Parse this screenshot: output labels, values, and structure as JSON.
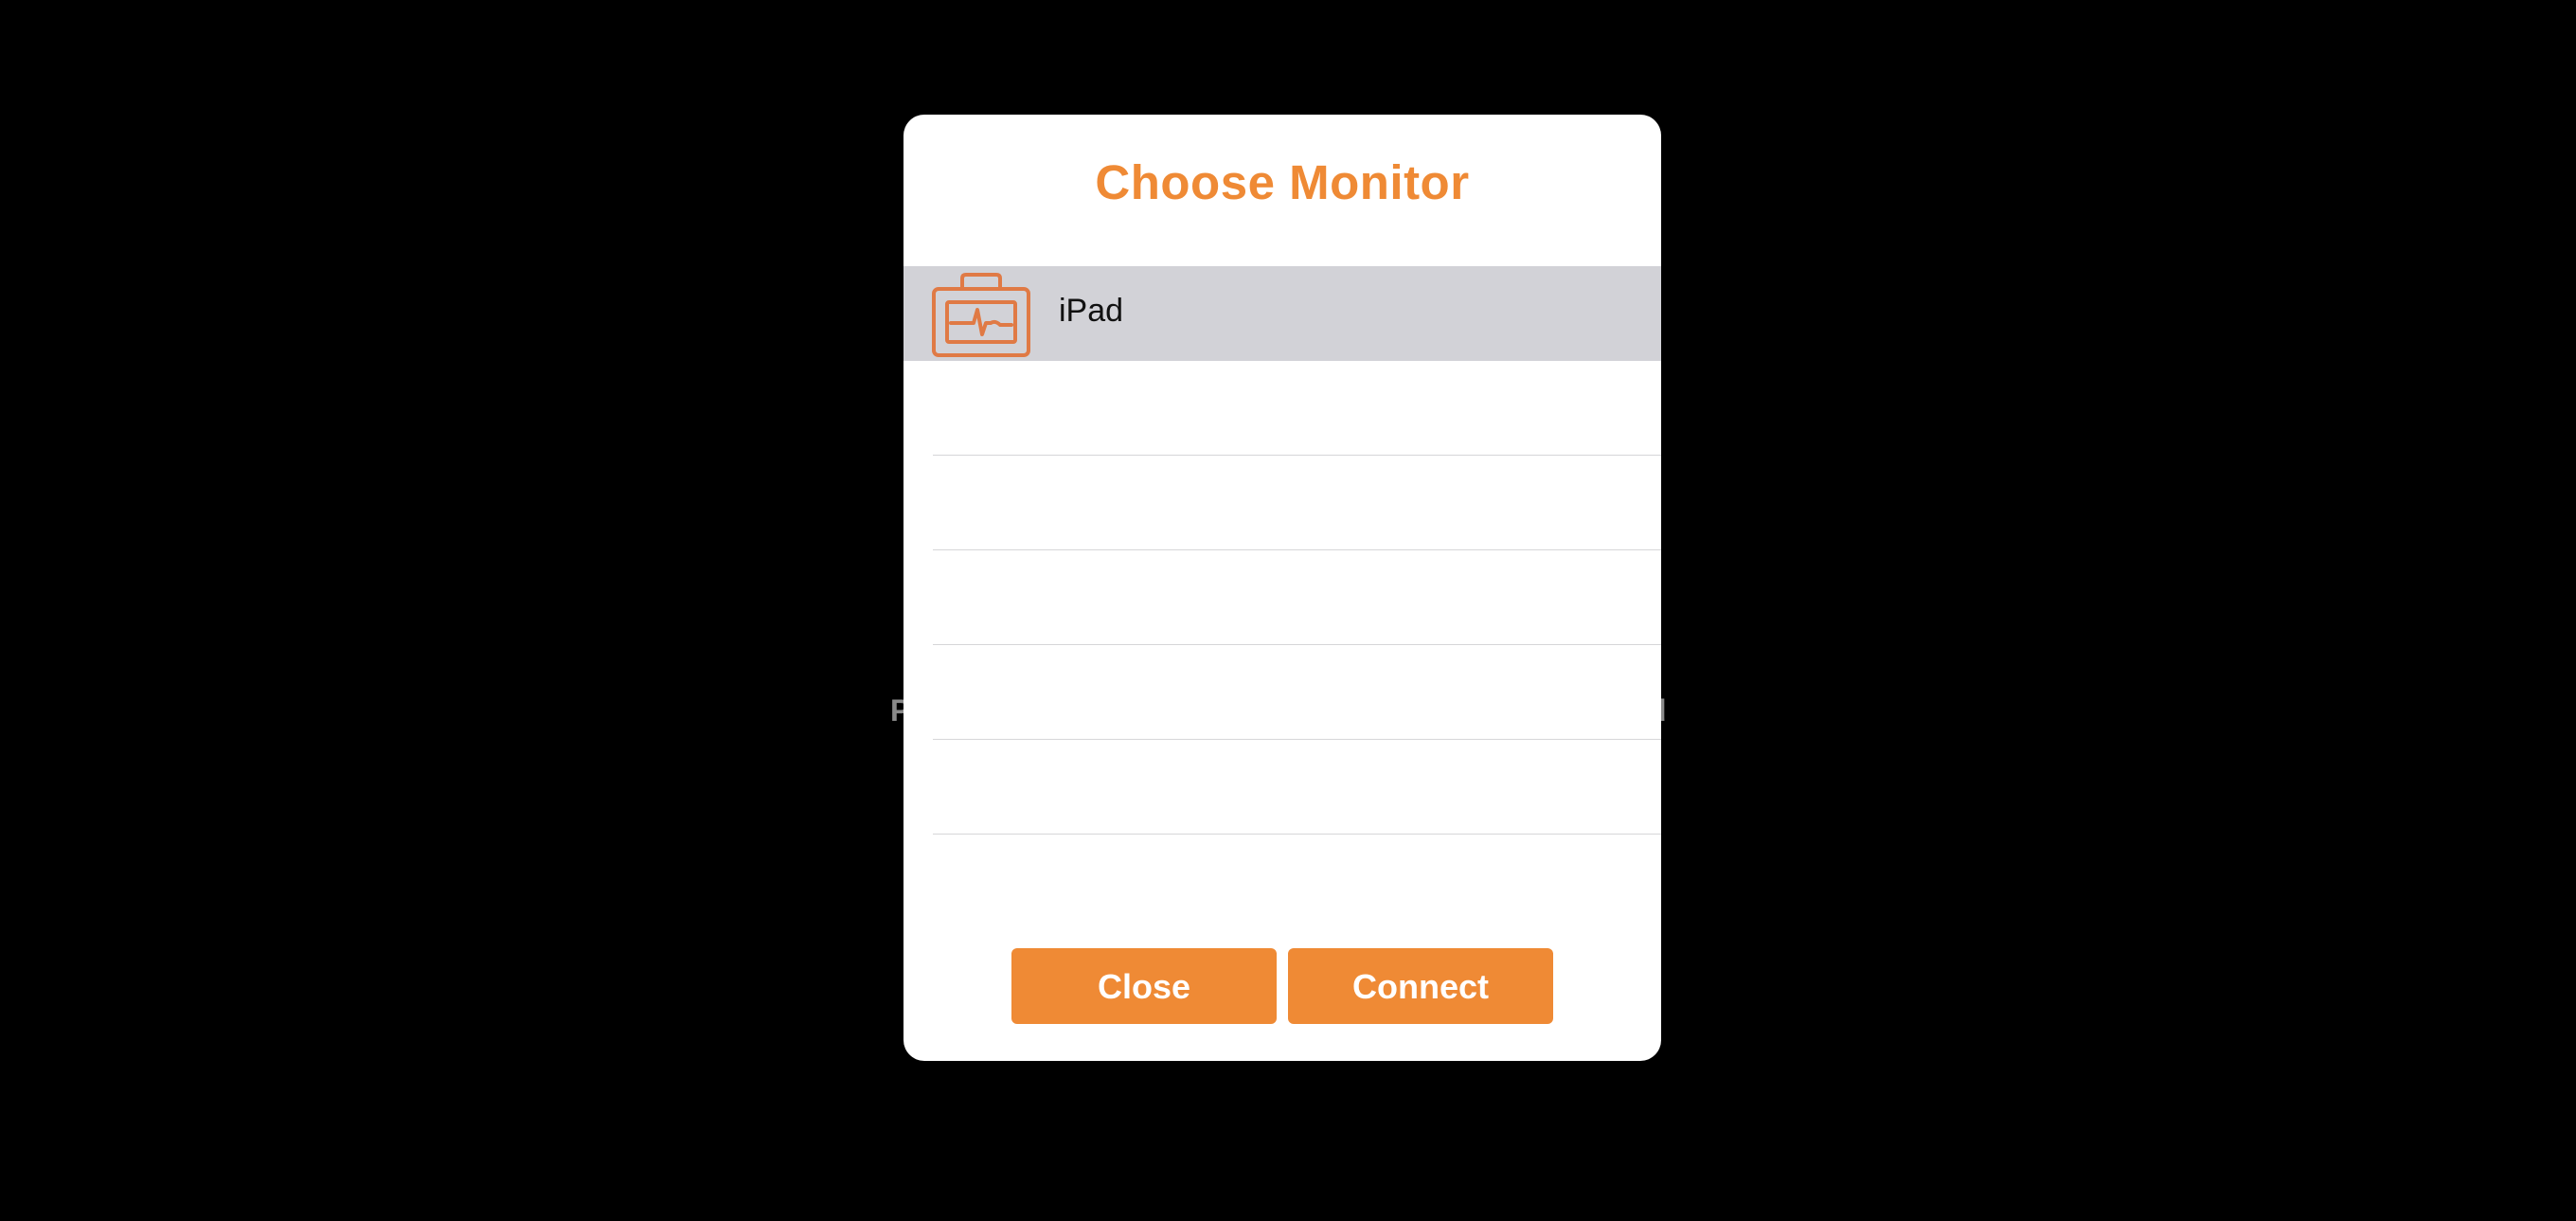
{
  "background": {
    "left_fragment": "P",
    "right_fragment": "d"
  },
  "dialog": {
    "title": "Choose Monitor",
    "devices": [
      {
        "label": "iPad",
        "icon": "monitor-case-icon",
        "selected": true
      }
    ],
    "empty_rows": 5,
    "close_label": "Close",
    "connect_label": "Connect"
  },
  "colors": {
    "accent": "#ef8a35",
    "selected_row": "#d2d2d7",
    "icon_stroke": "#e07a45"
  }
}
